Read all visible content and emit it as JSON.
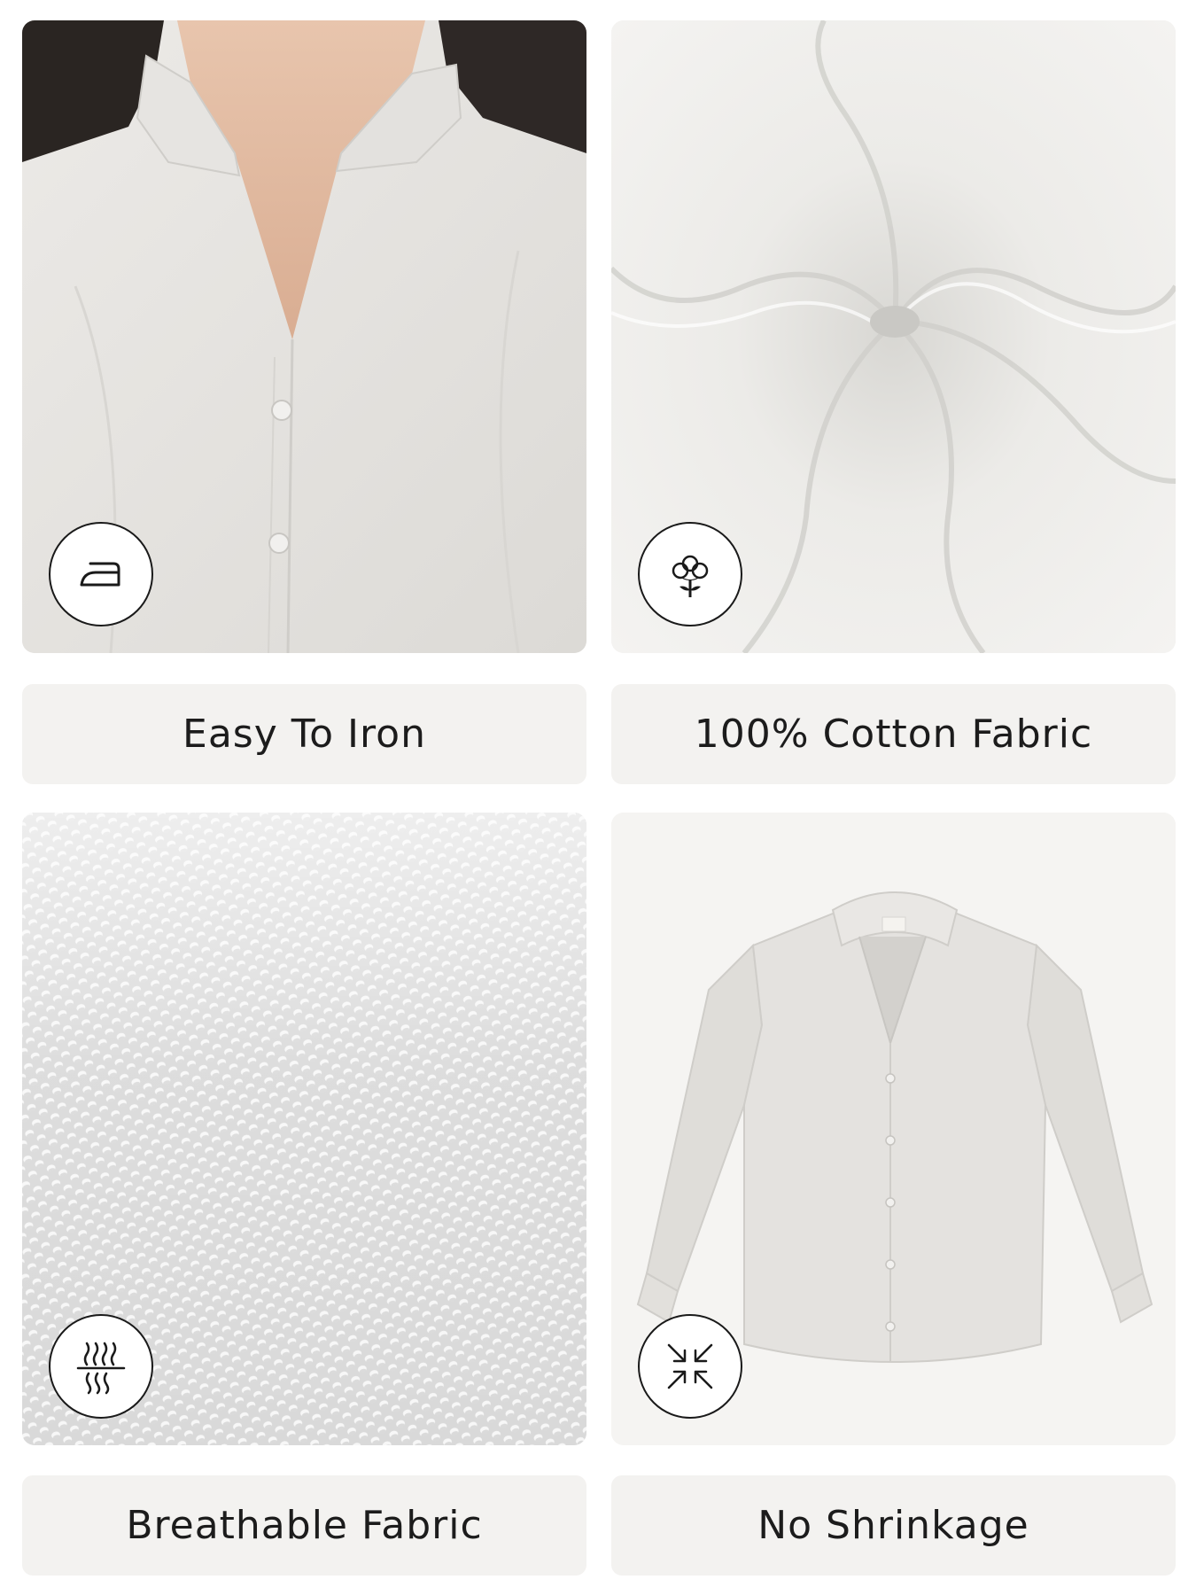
{
  "features": [
    {
      "label": "Easy To Iron",
      "icon": "iron-icon",
      "photo": "shirt-collar-closeup"
    },
    {
      "label": "100% Cotton Fabric",
      "icon": "cotton-flower-icon",
      "photo": "swirled-cotton-fabric"
    },
    {
      "label": "Breathable Fabric",
      "icon": "breathable-fabric-icon",
      "photo": "fabric-weave-macro"
    },
    {
      "label": "No Shrinkage",
      "icon": "no-shrinkage-arrows-icon",
      "photo": "full-shirt-flatlay"
    }
  ],
  "colors": {
    "label_background": "#f3f2f0",
    "label_text": "#1c1c1c",
    "shirt": "#e4e2df",
    "badge_border": "#1a1a1a"
  }
}
